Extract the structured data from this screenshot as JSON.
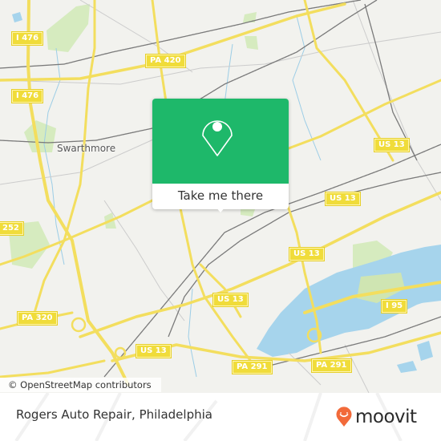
{
  "map": {
    "colors": {
      "background": "#f2f2ee",
      "road_major": "#f3de5e",
      "water": "#a6d4ec",
      "park": "#d6ebbf",
      "rail": "#777777",
      "minor_road": "#c9c9c9",
      "shield_bg": "#f0dc3a"
    },
    "place_labels": [
      {
        "name": "Swarthmore"
      }
    ],
    "road_shields": [
      {
        "label": "I 476"
      },
      {
        "label": "I 476"
      },
      {
        "label": "PA 420"
      },
      {
        "label": "US 13"
      },
      {
        "label": "US 13"
      },
      {
        "label": "US 13"
      },
      {
        "label": "US 13"
      },
      {
        "label": "252"
      },
      {
        "label": "PA 320"
      },
      {
        "label": "I 95"
      },
      {
        "label": "US 13"
      },
      {
        "label": "PA 291"
      },
      {
        "label": "PA 291"
      }
    ],
    "attribution": "© OpenStreetMap contributors"
  },
  "popup": {
    "icon": "location-pin-icon",
    "button_label": "Take me there",
    "accent_color": "#1eb86a"
  },
  "footer": {
    "title": "Rogers Auto Repair, Philadelphia",
    "logo_text": "moovit",
    "logo_icon": "moovit-smile-pin-icon",
    "logo_color": "#f26a3a"
  }
}
